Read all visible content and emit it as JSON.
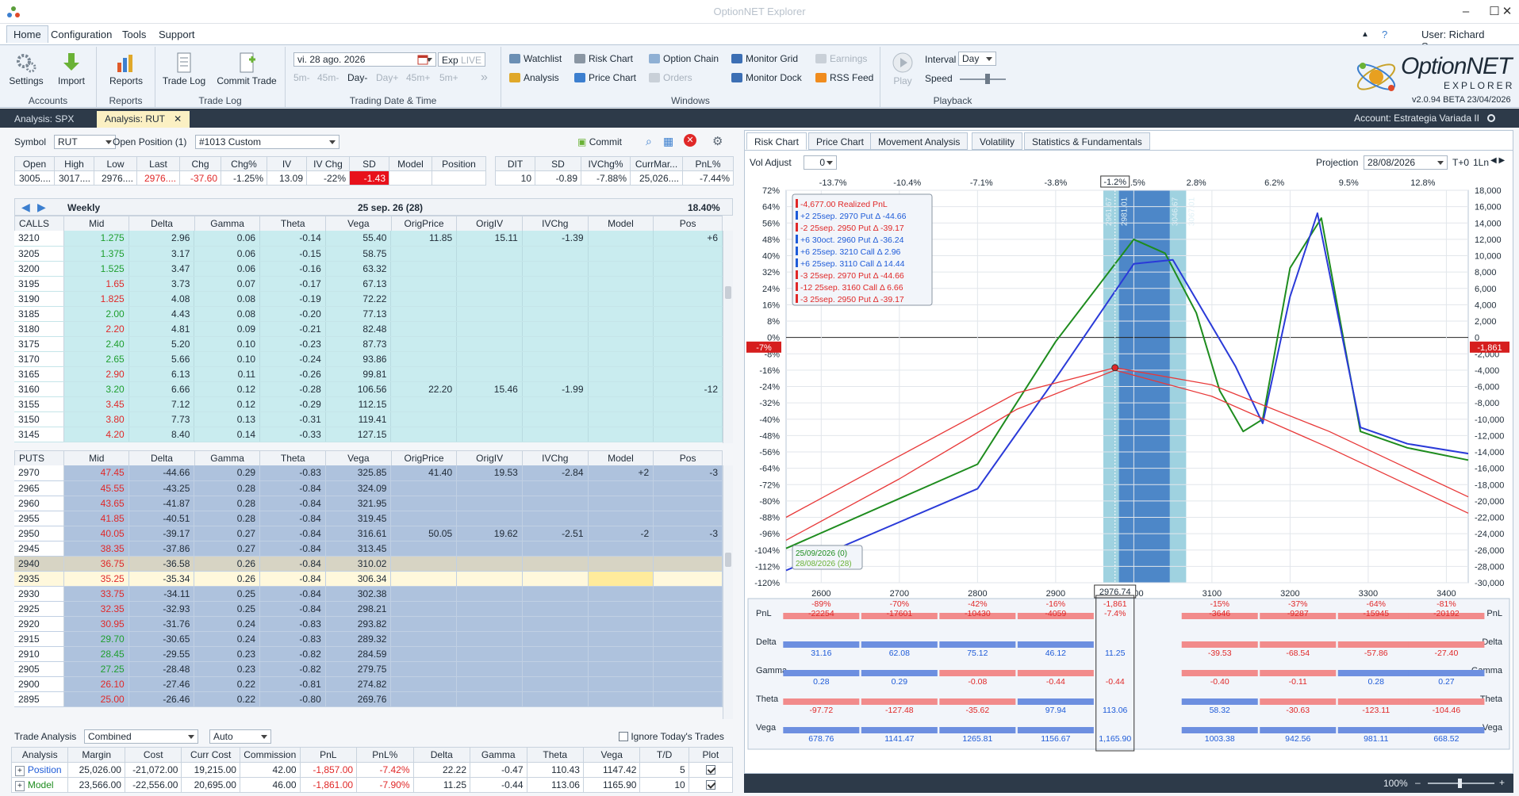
{
  "app": {
    "title": "OptionNET Explorer",
    "user": "User: Richard Saenz",
    "version": "v2.0.94 BETA 23/04/2026",
    "logo_text": "OptionNET",
    "logo_sub": "EXPLORER"
  },
  "menu": [
    "Home",
    "Configuration",
    "Tools",
    "Support"
  ],
  "ribbon": {
    "accounts": {
      "label": "Accounts",
      "settings": "Settings",
      "import": "Import"
    },
    "reports": {
      "label": "Reports",
      "reports": "Reports"
    },
    "tradelog": {
      "label": "Trade Log",
      "trade_log": "Trade Log",
      "commit_trade": "Commit Trade"
    },
    "trading": {
      "label": "Trading Date & Time",
      "date": "vi. 28 ago. 2026",
      "exp": "Exp",
      "live": "LIVE",
      "steps": [
        "5m-",
        "45m-",
        "Day-",
        "Day+",
        "45m+",
        "5m+"
      ]
    },
    "windows": {
      "label": "Windows",
      "watchlist": "Watchlist",
      "analysis": "Analysis",
      "risk_chart": "Risk Chart",
      "price_chart": "Price Chart",
      "option_chain": "Option Chain",
      "orders": "Orders",
      "monitor_grid": "Monitor Grid",
      "monitor_dock": "Monitor Dock",
      "earnings": "Earnings",
      "rss": "RSS Feed"
    },
    "playback": {
      "label": "Playback",
      "play": "Play",
      "interval_label": "Interval",
      "interval": "Day",
      "speed_label": "Speed"
    }
  },
  "doctabs": [
    "Analysis: SPX",
    "Analysis: RUT"
  ],
  "account": "Account: Estrategia Variada II",
  "left": {
    "symbol_label": "Symbol",
    "symbol": "RUT",
    "open_position_label": "Open Position (1)",
    "open_position": "#1013 Custom",
    "commit": "Commit",
    "quote_headers": [
      "Open",
      "High",
      "Low",
      "Last",
      "Chg",
      "Chg%",
      "IV",
      "IV Chg",
      "SD",
      "Model",
      "Position"
    ],
    "quote_values": [
      "3005....",
      "3017....",
      "2976....",
      "2976....",
      "-37.60",
      "-1.25%",
      "13.09",
      "-22%",
      "-1.43",
      "",
      ""
    ],
    "stats_headers": [
      "DIT",
      "SD",
      "IVChg%",
      "CurrMar...",
      "PnL%"
    ],
    "stats_values": [
      "10",
      "-0.89",
      "-7.88%",
      "25,026....",
      "-7.44%"
    ],
    "expiry_name": "Weekly",
    "expiry_date": "25 sep. 26 (28)",
    "expiry_iv": "18.40%",
    "chain_headers": [
      "Mid",
      "Delta",
      "Gamma",
      "Theta",
      "Vega",
      "OrigPrice",
      "OrigIV",
      "IVChg",
      "Model",
      "Pos"
    ],
    "calls_label": "CALLS",
    "puts_label": "PUTS",
    "calls": [
      [
        "3210",
        "1.275",
        "2.96",
        "0.06",
        "-0.14",
        "55.40",
        "11.85",
        "15.11",
        "-1.39",
        "",
        "+6"
      ],
      [
        "3205",
        "1.375",
        "3.17",
        "0.06",
        "-0.15",
        "58.75",
        "",
        "",
        "",
        "",
        ""
      ],
      [
        "3200",
        "1.525",
        "3.47",
        "0.06",
        "-0.16",
        "63.32",
        "",
        "",
        "",
        "",
        ""
      ],
      [
        "3195",
        "1.65",
        "3.73",
        "0.07",
        "-0.17",
        "67.13",
        "",
        "",
        "",
        "",
        ""
      ],
      [
        "3190",
        "1.825",
        "4.08",
        "0.08",
        "-0.19",
        "72.22",
        "",
        "",
        "",
        "",
        ""
      ],
      [
        "3185",
        "2.00",
        "4.43",
        "0.08",
        "-0.20",
        "77.13",
        "",
        "",
        "",
        "",
        ""
      ],
      [
        "3180",
        "2.20",
        "4.81",
        "0.09",
        "-0.21",
        "82.48",
        "",
        "",
        "",
        "",
        ""
      ],
      [
        "3175",
        "2.40",
        "5.20",
        "0.10",
        "-0.23",
        "87.73",
        "",
        "",
        "",
        "",
        ""
      ],
      [
        "3170",
        "2.65",
        "5.66",
        "0.10",
        "-0.24",
        "93.86",
        "",
        "",
        "",
        "",
        ""
      ],
      [
        "3165",
        "2.90",
        "6.13",
        "0.11",
        "-0.26",
        "99.81",
        "",
        "",
        "",
        "",
        ""
      ],
      [
        "3160",
        "3.20",
        "6.66",
        "0.12",
        "-0.28",
        "106.56",
        "22.20",
        "15.46",
        "-1.99",
        "",
        "-12"
      ],
      [
        "3155",
        "3.45",
        "7.12",
        "0.12",
        "-0.29",
        "112.15",
        "",
        "",
        "",
        "",
        ""
      ],
      [
        "3150",
        "3.80",
        "7.73",
        "0.13",
        "-0.31",
        "119.41",
        "",
        "",
        "",
        "",
        ""
      ],
      [
        "3145",
        "4.20",
        "8.40",
        "0.14",
        "-0.33",
        "127.15",
        "",
        "",
        "",
        "",
        ""
      ]
    ],
    "call_colors": [
      "grn",
      "grn",
      "grn",
      "red",
      "red",
      "grn",
      "red",
      "grn",
      "grn",
      "red",
      "grn",
      "red",
      "red",
      "red"
    ],
    "puts": [
      [
        "2970",
        "47.45",
        "-44.66",
        "0.29",
        "-0.83",
        "325.85",
        "41.40",
        "19.53",
        "-2.84",
        "+2",
        "-3"
      ],
      [
        "2965",
        "45.55",
        "-43.25",
        "0.28",
        "-0.84",
        "324.09",
        "",
        "",
        "",
        "",
        ""
      ],
      [
        "2960",
        "43.65",
        "-41.87",
        "0.28",
        "-0.84",
        "321.95",
        "",
        "",
        "",
        "",
        ""
      ],
      [
        "2955",
        "41.85",
        "-40.51",
        "0.28",
        "-0.84",
        "319.45",
        "",
        "",
        "",
        "",
        ""
      ],
      [
        "2950",
        "40.05",
        "-39.17",
        "0.27",
        "-0.84",
        "316.61",
        "50.05",
        "19.62",
        "-2.51",
        "-2",
        "-3"
      ],
      [
        "2945",
        "38.35",
        "-37.86",
        "0.27",
        "-0.84",
        "313.45",
        "",
        "",
        "",
        "",
        ""
      ],
      [
        "2940",
        "36.75",
        "-36.58",
        "0.26",
        "-0.84",
        "310.02",
        "",
        "",
        "",
        "",
        ""
      ],
      [
        "2935",
        "35.25",
        "-35.34",
        "0.26",
        "-0.84",
        "306.34",
        "",
        "",
        "",
        "",
        ""
      ],
      [
        "2930",
        "33.75",
        "-34.11",
        "0.25",
        "-0.84",
        "302.38",
        "",
        "",
        "",
        "",
        ""
      ],
      [
        "2925",
        "32.35",
        "-32.93",
        "0.25",
        "-0.84",
        "298.21",
        "",
        "",
        "",
        "",
        ""
      ],
      [
        "2920",
        "30.95",
        "-31.76",
        "0.24",
        "-0.83",
        "293.82",
        "",
        "",
        "",
        "",
        ""
      ],
      [
        "2915",
        "29.70",
        "-30.65",
        "0.24",
        "-0.83",
        "289.32",
        "",
        "",
        "",
        "",
        ""
      ],
      [
        "2910",
        "28.45",
        "-29.55",
        "0.23",
        "-0.82",
        "284.59",
        "",
        "",
        "",
        "",
        ""
      ],
      [
        "2905",
        "27.25",
        "-28.48",
        "0.23",
        "-0.82",
        "279.75",
        "",
        "",
        "",
        "",
        ""
      ],
      [
        "2900",
        "26.10",
        "-27.46",
        "0.22",
        "-0.81",
        "274.82",
        "",
        "",
        "",
        "",
        ""
      ],
      [
        "2895",
        "25.00",
        "-26.46",
        "0.22",
        "-0.80",
        "269.76",
        "",
        "",
        "",
        "",
        ""
      ]
    ],
    "put_colors": [
      "red",
      "red",
      "red",
      "red",
      "red",
      "red",
      "red",
      "red",
      "red",
      "red",
      "red",
      "grn",
      "grn",
      "grn",
      "red",
      "red"
    ],
    "trade_analysis_label": "Trade Analysis",
    "ta_mode": "Combined",
    "ta_auto": "Auto",
    "ignore_today": "Ignore Today's Trades",
    "ta_headers": [
      "Analysis",
      "Margin",
      "Cost",
      "Curr Cost",
      "Commission",
      "PnL",
      "PnL%",
      "Delta",
      "Gamma",
      "Theta",
      "Vega",
      "T/D",
      "Plot"
    ],
    "ta_rows": [
      [
        "Position",
        "25,026.00",
        "-21,072.00",
        "19,215.00",
        "42.00",
        "-1,857.00",
        "-7.42%",
        "22.22",
        "-0.47",
        "110.43",
        "1147.42",
        "5"
      ],
      [
        "Model",
        "23,566.00",
        "-22,556.00",
        "20,695.00",
        "46.00",
        "-1,861.00",
        "-7.90%",
        "11.25",
        "-0.44",
        "113.06",
        "1165.90",
        "10"
      ]
    ]
  },
  "right": {
    "tabs": [
      "Risk Chart",
      "Price Chart",
      "Movement Analysis",
      "Volatility",
      "Statistics & Fundamentals"
    ],
    "vol_adjust_label": "Vol Adjust",
    "vol_adjust": "0",
    "projection_label": "Projection",
    "projection": "28/08/2026",
    "t0": "T+0",
    "ln": "1Ln",
    "zoom": "100%",
    "legend": [
      "-4,677.00 Realized PnL",
      "+2 25sep. 2970 Put Δ -44.66",
      "-2 25sep. 2950 Put Δ -39.17",
      "+6 30oct. 2960 Put Δ -36.24",
      "+6 25sep. 3210 Call Δ 2.96",
      "+6 25sep. 3110 Call Δ 14.44",
      "-3 25sep. 2970 Put Δ -44.66",
      "-12 25sep. 3160 Call Δ 6.66",
      "-3 25sep. 2950 Put Δ -39.17"
    ],
    "legend_colors": [
      "#e02828",
      "#1e5bd8",
      "#e02828",
      "#1e5bd8",
      "#1e5bd8",
      "#1e5bd8",
      "#e02828",
      "#e02828",
      "#e02828"
    ],
    "date_legend": [
      "25/09/2026 (0)",
      "28/08/2026 (28)"
    ],
    "left_badge": "-7%",
    "right_badge": "-1,861",
    "price_marker": "2976.74",
    "top_marker": "-1.2%",
    "band_labels": [
      "2961.67",
      "2981.01",
      "3046.67",
      "3067.01"
    ]
  },
  "chart_data": {
    "type": "line",
    "x_ticks": [
      2600,
      2700,
      2800,
      2900,
      3000,
      3100,
      3200,
      3300,
      3400
    ],
    "xlim": [
      2555,
      3428
    ],
    "top_pct_ticks": [
      "-13.7%",
      "-10.4%",
      "-7.1%",
      "-3.8%",
      "-1.2%",
      ".5%",
      "2.8%",
      "6.2%",
      "9.5%",
      "12.8%"
    ],
    "yleft_ticks": [
      "72%",
      "64%",
      "56%",
      "48%",
      "40%",
      "32%",
      "24%",
      "16%",
      "8%",
      "0%",
      "-8%",
      "-16%",
      "-24%",
      "-32%",
      "-40%",
      "-48%",
      "-56%",
      "-64%",
      "-72%",
      "-80%",
      "-88%",
      "-96%",
      "-104%",
      "-112%",
      "-120%"
    ],
    "yright_ticks": [
      "18,000",
      "16,000",
      "14,000",
      "12,000",
      "10,000",
      "8,000",
      "6,000",
      "4,000",
      "2,000",
      "0",
      "-2,000",
      "-4,000",
      "-6,000",
      "-8,000",
      "-10,000",
      "-12,000",
      "-14,000",
      "-16,000",
      "-18,000",
      "-20,000",
      "-22,000",
      "-24,000",
      "-26,000",
      "-28,000",
      "-30,000"
    ],
    "ylim": [
      -30000,
      18000
    ],
    "series": [
      {
        "color": "#1e8c1e",
        "points": [
          [
            2555,
            -25800
          ],
          [
            2800,
            -15500
          ],
          [
            2900,
            -500
          ],
          [
            3000,
            12000
          ],
          [
            3040,
            10300
          ],
          [
            3080,
            3000
          ],
          [
            3110,
            -6500
          ],
          [
            3140,
            -11500
          ],
          [
            3165,
            -10000
          ],
          [
            3200,
            8500
          ],
          [
            3240,
            14600
          ],
          [
            3290,
            -11500
          ],
          [
            3350,
            -13500
          ],
          [
            3428,
            -15000
          ]
        ]
      },
      {
        "color": "#2a3ad8",
        "points": [
          [
            2555,
            -28500
          ],
          [
            2800,
            -18500
          ],
          [
            2900,
            -5000
          ],
          [
            3000,
            9000
          ],
          [
            3050,
            9500
          ],
          [
            3090,
            3000
          ],
          [
            3130,
            -3500
          ],
          [
            3165,
            -10500
          ],
          [
            3200,
            5000
          ],
          [
            3235,
            15200
          ],
          [
            3290,
            -11000
          ],
          [
            3350,
            -13000
          ],
          [
            3428,
            -14200
          ]
        ]
      },
      {
        "color": "#e83838",
        "points": [
          [
            2555,
            -22000
          ],
          [
            2700,
            -14500
          ],
          [
            2850,
            -6800
          ],
          [
            2976,
            -3700
          ],
          [
            3100,
            -5800
          ],
          [
            3250,
            -11500
          ],
          [
            3428,
            -19500
          ]
        ]
      },
      {
        "color": "#e83838",
        "points": [
          [
            2555,
            -24800
          ],
          [
            2700,
            -17300
          ],
          [
            2850,
            -8800
          ],
          [
            2976,
            -4000
          ],
          [
            3100,
            -7200
          ],
          [
            3250,
            -13500
          ],
          [
            3428,
            -21500
          ]
        ]
      }
    ],
    "bottom_rows": [
      {
        "label": "PnL",
        "values": [
          "-89%\n-22254",
          "-70%\n-17601",
          "-42%\n-10430",
          "-16%\n-4059",
          "-1,861\n-7.4%",
          "-15%\n-3646",
          "-37%\n-9287",
          "-64%\n-15945",
          "-81%\n-20192"
        ]
      },
      {
        "label": "Delta",
        "values": [
          "31.16",
          "62.08",
          "75.12",
          "46.12",
          "11.25",
          "-39.53",
          "-68.54",
          "-57.86",
          "-27.40"
        ]
      },
      {
        "label": "Gamma",
        "values": [
          "0.28",
          "0.29",
          "-0.08",
          "-0.44",
          "-0.44",
          "-0.40",
          "-0.11",
          "0.28",
          "0.27"
        ]
      },
      {
        "label": "Theta",
        "values": [
          "-97.72",
          "-127.48",
          "-35.62",
          "97.94",
          "113.06",
          "58.32",
          "-30.63",
          "-123.11",
          "-104.46"
        ]
      },
      {
        "label": "Vega",
        "values": [
          "678.76",
          "1141.47",
          "1265.81",
          "1156.67",
          "1,165.90",
          "1003.38",
          "942.56",
          "981.11",
          "668.52"
        ]
      }
    ]
  }
}
